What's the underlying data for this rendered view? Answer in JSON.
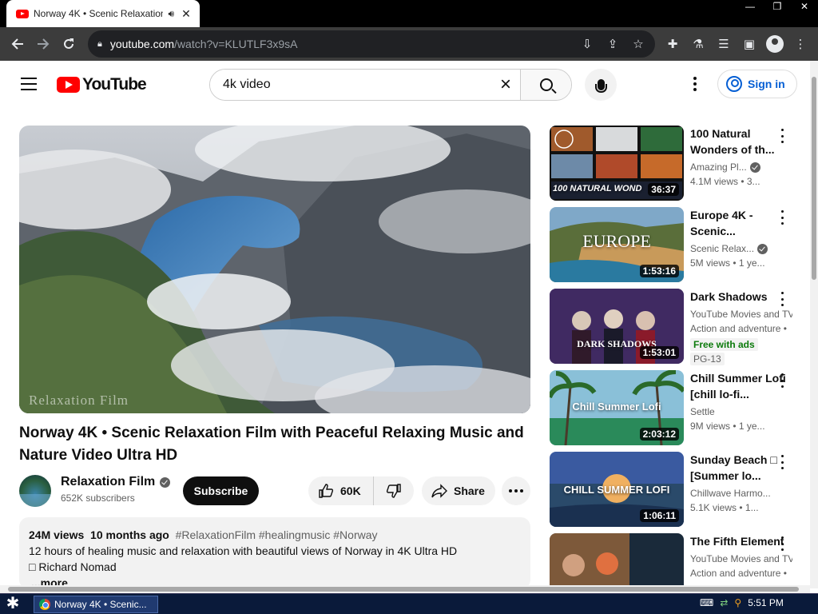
{
  "browser": {
    "tab_title": "Norway 4K • Scenic Relaxation",
    "url_host": "youtube.com",
    "url_path": "/watch?v=KLUTLF3x9sA"
  },
  "masthead": {
    "logo_text": "YouTube",
    "search_value": "4k video",
    "search_placeholder": "Search",
    "signin_label": "Sign in"
  },
  "video": {
    "watermark": "Relaxation Film",
    "title": "Norway 4K • Scenic Relaxation Film with Peaceful Relaxing Music and Nature Video Ultra HD",
    "channel": "Relaxation Film",
    "subscribers": "652K subscribers",
    "subscribe_label": "Subscribe",
    "likes": "60K",
    "share_label": "Share",
    "description": {
      "views": "24M views",
      "age": "10 months ago",
      "tags": "#RelaxationFilm #healingmusic #Norway",
      "line1": "12 hours of healing music and relaxation with beautiful views of Norway in 4K Ultra HD",
      "line2": "Richard Nomad",
      "more": "...more"
    }
  },
  "recommendations": [
    {
      "title": "100 Natural Wonders of th...",
      "channel": "Amazing Pl...",
      "verified": true,
      "meta": "4.1M views • 3...",
      "duration": "36:37",
      "overlay": "100 NATURAL WOND"
    },
    {
      "title": "Europe 4K - Scenic...",
      "channel": "Scenic Relax...",
      "verified": true,
      "meta": "5M views • 1 ye...",
      "duration": "1:53:16",
      "overlay": "EUROPE"
    },
    {
      "title": "Dark Shadows",
      "channel": "YouTube Movies and TV",
      "verified": false,
      "meta": "Action and adventure •",
      "duration": "1:53:01",
      "overlay": "DARK SHADOWS",
      "badge_free": "Free with ads",
      "badge_rating": "PG-13"
    },
    {
      "title": "Chill Summer Lofi [chill lo-fi...",
      "channel": "Settle",
      "verified": false,
      "meta": "9M views • 1 ye...",
      "duration": "2:03:12",
      "overlay": "Chill Summer Lofi"
    },
    {
      "title": "Sunday Beach □ [Summer lo...",
      "channel": "Chillwave Harmo...",
      "verified": false,
      "meta": "5.1K views • 1...",
      "duration": "1:06:11",
      "overlay": "CHILL SUMMER LOFI"
    },
    {
      "title": "The Fifth Element",
      "channel": "YouTube Movies and TV",
      "verified": false,
      "meta": "Action and adventure •",
      "duration": "",
      "overlay": ""
    }
  ],
  "taskbar": {
    "task_label": "Norway 4K • Scenic...",
    "time": "5:51 PM"
  },
  "colors": {
    "brand_red": "#ff0000",
    "link_blue": "#065fd4",
    "free_green": "#0b7a0b"
  }
}
